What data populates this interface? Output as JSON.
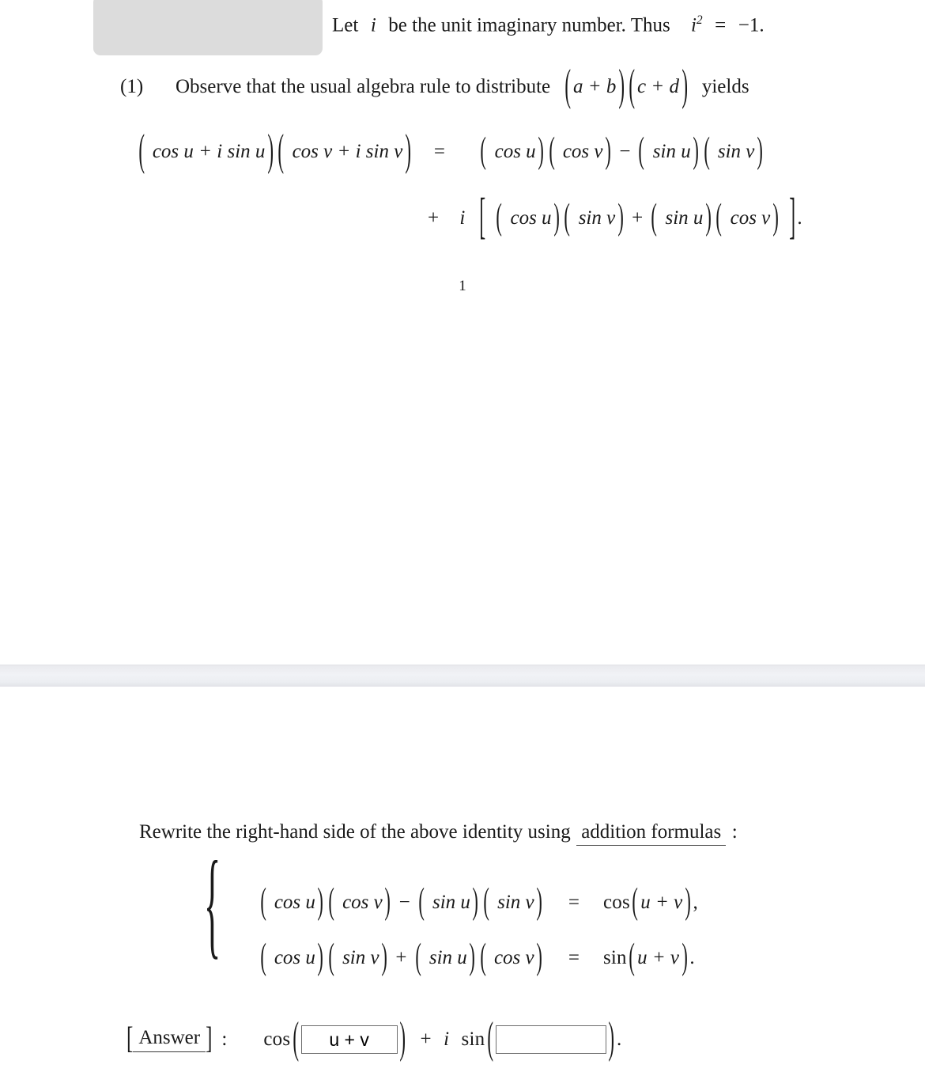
{
  "document": {
    "page_number": "1"
  },
  "placeholder": {
    "name": "image-placeholder",
    "fill_color": "#dcdcdc"
  },
  "header": {
    "let": "Let",
    "i": "i",
    "be_phrase": "be the unit imaginary number. Thus",
    "i_squared": "i",
    "exponent": "2",
    "equals": "=",
    "value": "−1."
  },
  "item_one": {
    "number": "(1)",
    "text_before": "Observe that the usual algebra rule to distribute",
    "factor1": "a + b",
    "factor2": "c + d",
    "text_after": "yields"
  },
  "display_equation": {
    "line1": {
      "left_factor1": "cos u + i sin u",
      "left_factor2": "cos v + i sin v",
      "equals": "=",
      "t1": "cos u",
      "t2": "cos v",
      "minus": "−",
      "t3": "sin u",
      "t4": "sin v"
    },
    "line2": {
      "plus": "+",
      "i": "i",
      "t1": "cos u",
      "t2": "sin v",
      "plus2": "+",
      "t3": "sin u",
      "t4": "cos v",
      "period": "."
    }
  },
  "rewrite_prompt": {
    "text_before": "Rewrite the right-hand side of the above identity using",
    "underlined_term": "addition formulas",
    "colon": ":"
  },
  "formula_system": {
    "rows": [
      {
        "t1": "cos u",
        "t2": "cos v",
        "sign": "−",
        "t3": "sin u",
        "t4": "sin v",
        "equals": "=",
        "result_fn": "cos",
        "result_arg": "u + v",
        "terminator": ","
      },
      {
        "t1": "cos u",
        "t2": "sin v",
        "sign": "+",
        "t3": "sin u",
        "t4": "cos v",
        "equals": "=",
        "result_fn": "sin",
        "result_arg": "u + v",
        "terminator": "."
      }
    ]
  },
  "answer_row": {
    "label": "Answer",
    "colon": ":",
    "cos_label": "cos",
    "cos_input_value": "u + v",
    "cos_input_placeholder": "",
    "plus": "+",
    "i": "i",
    "sin_label": "sin",
    "sin_input_value": "",
    "sin_input_placeholder": "",
    "period": "."
  }
}
